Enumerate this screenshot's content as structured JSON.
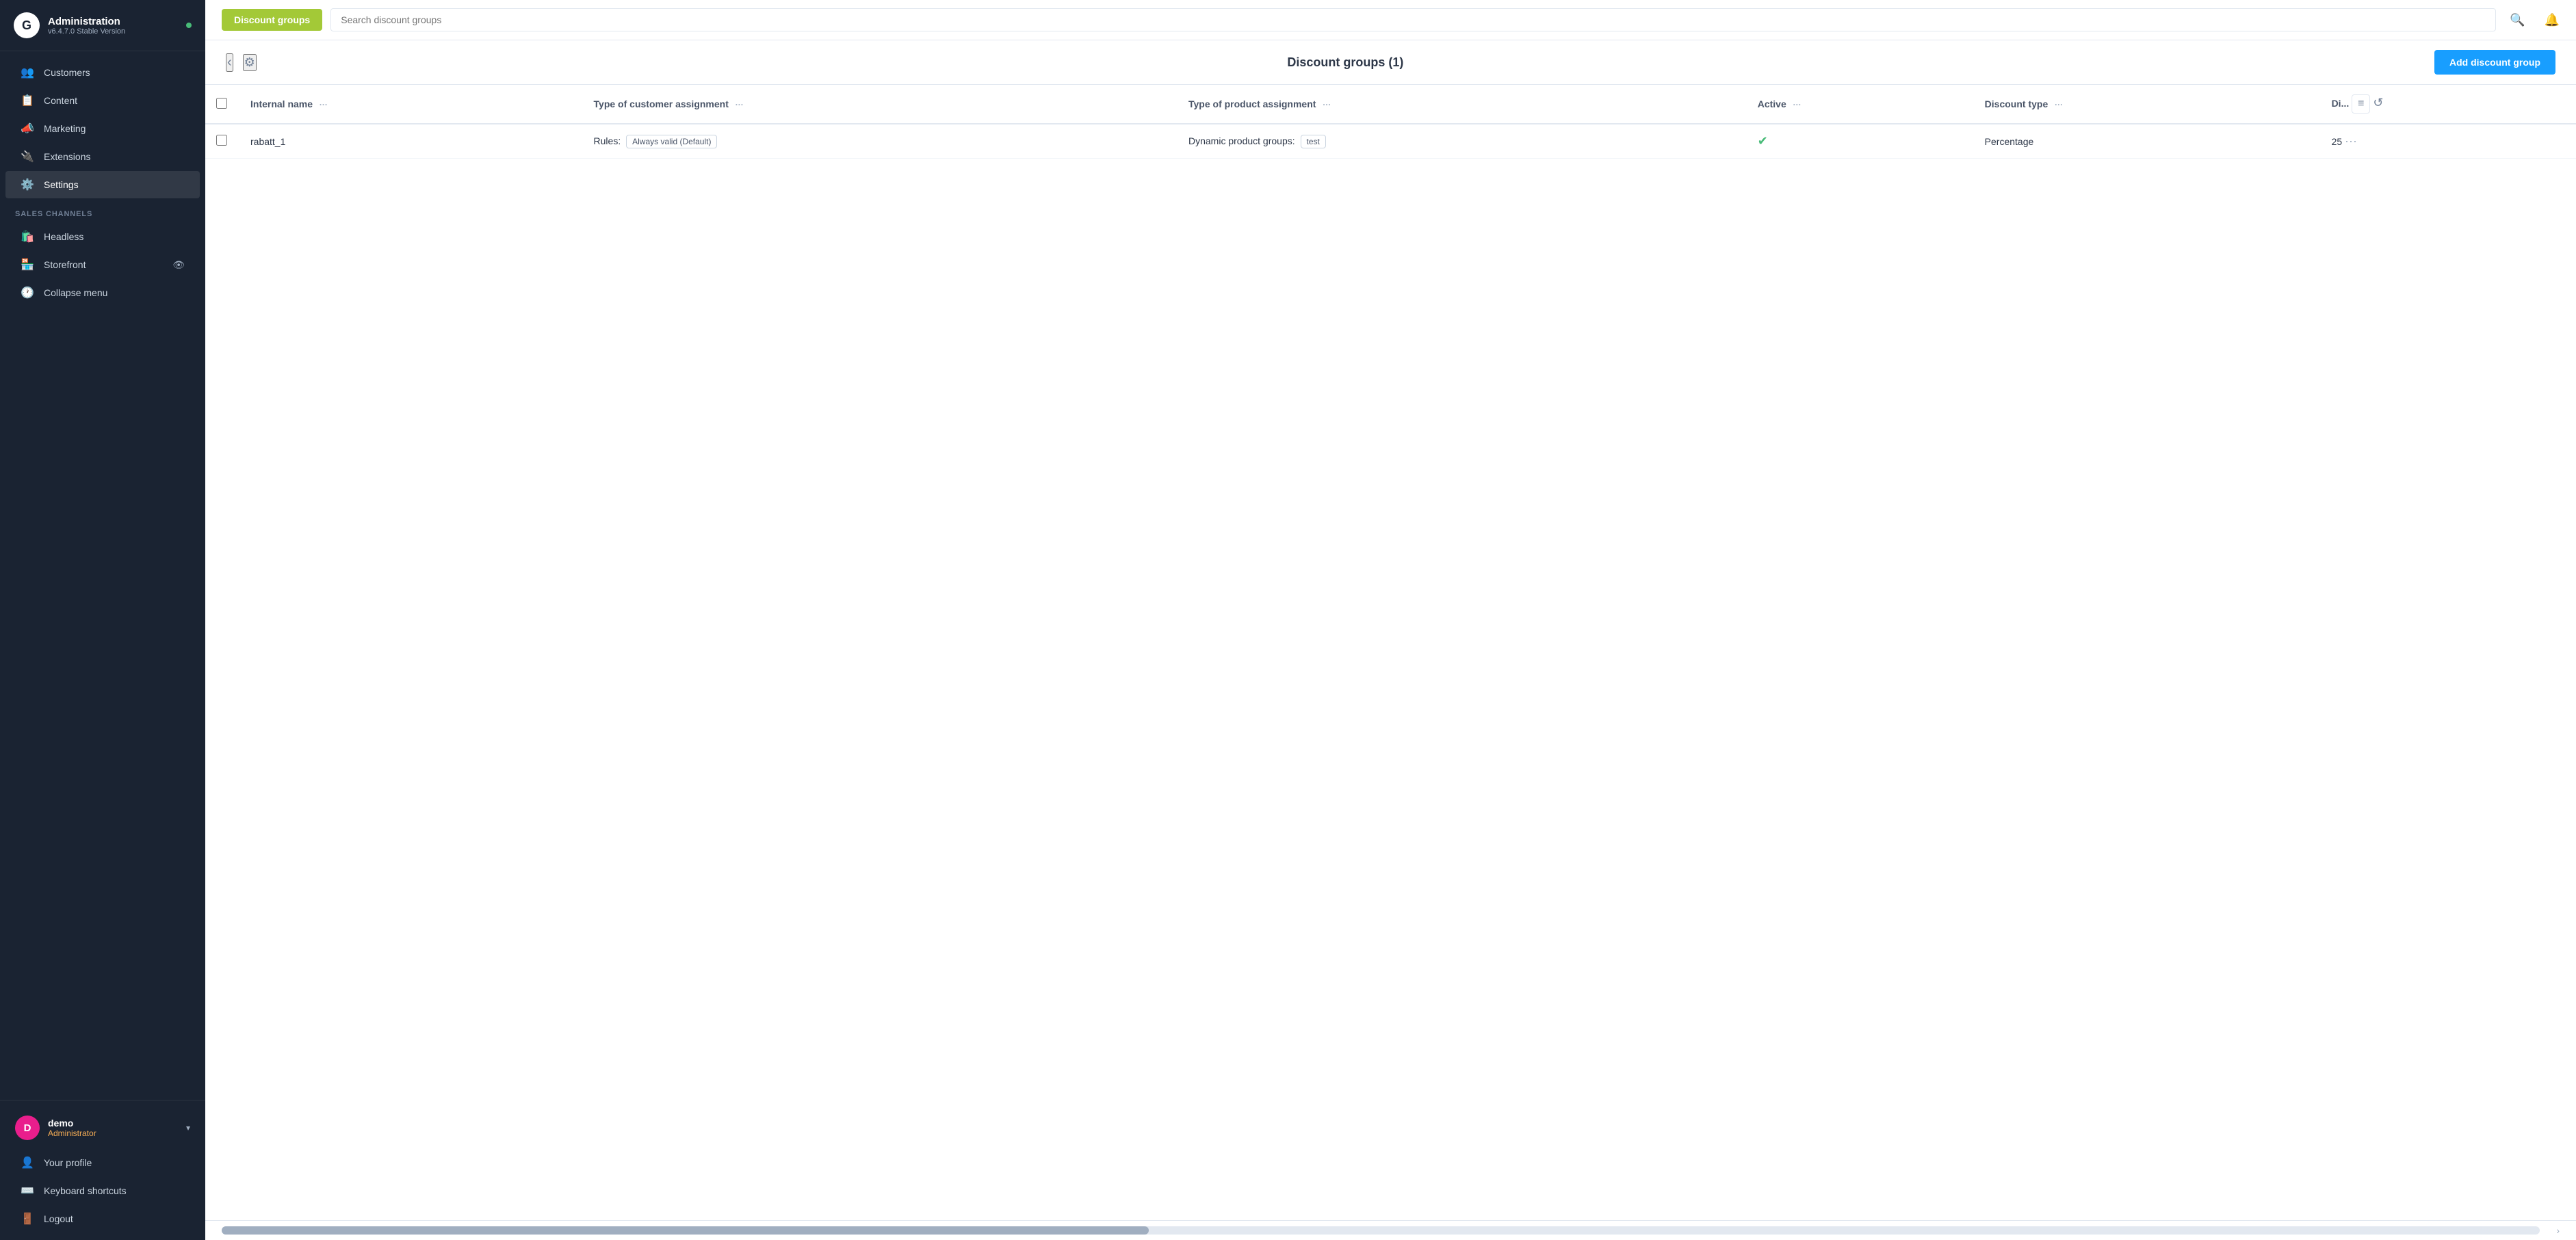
{
  "app": {
    "name": "Administration",
    "version": "v6.4.7.0 Stable Version",
    "status": "online"
  },
  "sidebar": {
    "nav_items": [
      {
        "id": "customers",
        "label": "Customers",
        "icon": "👥"
      },
      {
        "id": "content",
        "label": "Content",
        "icon": "📋"
      },
      {
        "id": "marketing",
        "label": "Marketing",
        "icon": "📣"
      },
      {
        "id": "extensions",
        "label": "Extensions",
        "icon": "🔌"
      },
      {
        "id": "settings",
        "label": "Settings",
        "icon": "⚙️",
        "active": true
      }
    ],
    "sales_channels": {
      "title": "Sales Channels",
      "items": [
        {
          "id": "headless",
          "label": "Headless"
        },
        {
          "id": "storefront",
          "label": "Storefront"
        },
        {
          "id": "collapse-menu",
          "label": "Collapse menu"
        }
      ]
    },
    "user": {
      "initials": "D",
      "name": "demo",
      "role": "Administrator"
    },
    "footer_items": [
      {
        "id": "profile",
        "label": "Your profile",
        "icon": "👤"
      },
      {
        "id": "keyboard-shortcuts",
        "label": "Keyboard shortcuts",
        "icon": "⌨️"
      },
      {
        "id": "logout",
        "label": "Logout",
        "icon": "🚪"
      }
    ]
  },
  "topbar": {
    "tab_label": "Discount groups",
    "search_placeholder": "Search discount groups",
    "search_icon": "🔍",
    "bell_icon": "🔔"
  },
  "page": {
    "title": "Discount groups",
    "count": "(1)",
    "add_button_label": "Add discount group"
  },
  "table": {
    "columns": [
      {
        "id": "internal-name",
        "label": "Internal name"
      },
      {
        "id": "customer-assignment",
        "label": "Type of customer assignment"
      },
      {
        "id": "product-assignment",
        "label": "Type of product assignment"
      },
      {
        "id": "active",
        "label": "Active"
      },
      {
        "id": "discount-type",
        "label": "Discount type"
      },
      {
        "id": "discount-value",
        "label": "Di..."
      }
    ],
    "rows": [
      {
        "id": "rabatt_1",
        "internal_name": "rabatt_1",
        "customer_assignment_prefix": "Rules:",
        "customer_assignment_tag": "Always valid (Default)",
        "product_assignment_prefix": "Dynamic product groups:",
        "product_assignment_tag": "test",
        "active": true,
        "discount_type": "Percentage",
        "discount_value": "25"
      }
    ]
  }
}
